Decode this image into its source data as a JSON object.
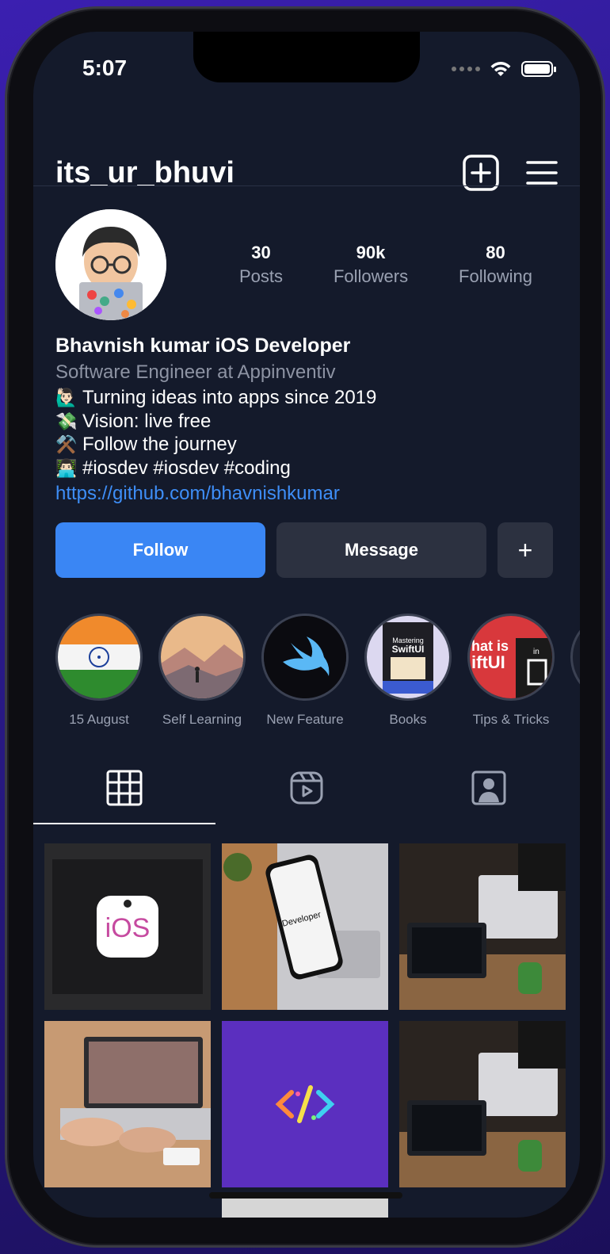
{
  "status_bar": {
    "time": "5:07"
  },
  "header": {
    "username": "its_ur_bhuvi"
  },
  "profile": {
    "stats": [
      {
        "count": "30",
        "label": "Posts"
      },
      {
        "count": "90k",
        "label": "Followers"
      },
      {
        "count": "80",
        "label": "Following"
      }
    ],
    "bio": {
      "name": "Bhavnish kumar iOS Developer",
      "subtitle": "Software Engineer at Appinventiv",
      "lines": [
        {
          "emoji": "🙋🏻‍♂️",
          "text": "Turning ideas into apps since 2019"
        },
        {
          "emoji": "💸",
          "text": "Vision: live free"
        },
        {
          "emoji": "⚒️",
          "text": "Follow the journey"
        },
        {
          "emoji": "👨🏻‍💻",
          "text": "#iosdev #iosdev #coding"
        }
      ],
      "link": "https://github.com/bhavnishkumar"
    }
  },
  "actions": {
    "follow": "Follow",
    "message": "Message",
    "more": "+"
  },
  "highlights": [
    {
      "label": "15 August"
    },
    {
      "label": "Self Learning"
    },
    {
      "label": "New Feature"
    },
    {
      "label": "Books",
      "book_title": "Mastering",
      "book_title2": "SwiftUI"
    },
    {
      "label": "Tips & Tricks",
      "thumb_text": "hat is",
      "thumb_text2": "iftUI",
      "thumb_text3": "in"
    }
  ],
  "grid": {
    "post1_text": "iOS",
    "post2_text": "Developer"
  },
  "colors": {
    "accent": "#3a86f4",
    "background": "#141a2b",
    "link": "#3e8ef7"
  }
}
